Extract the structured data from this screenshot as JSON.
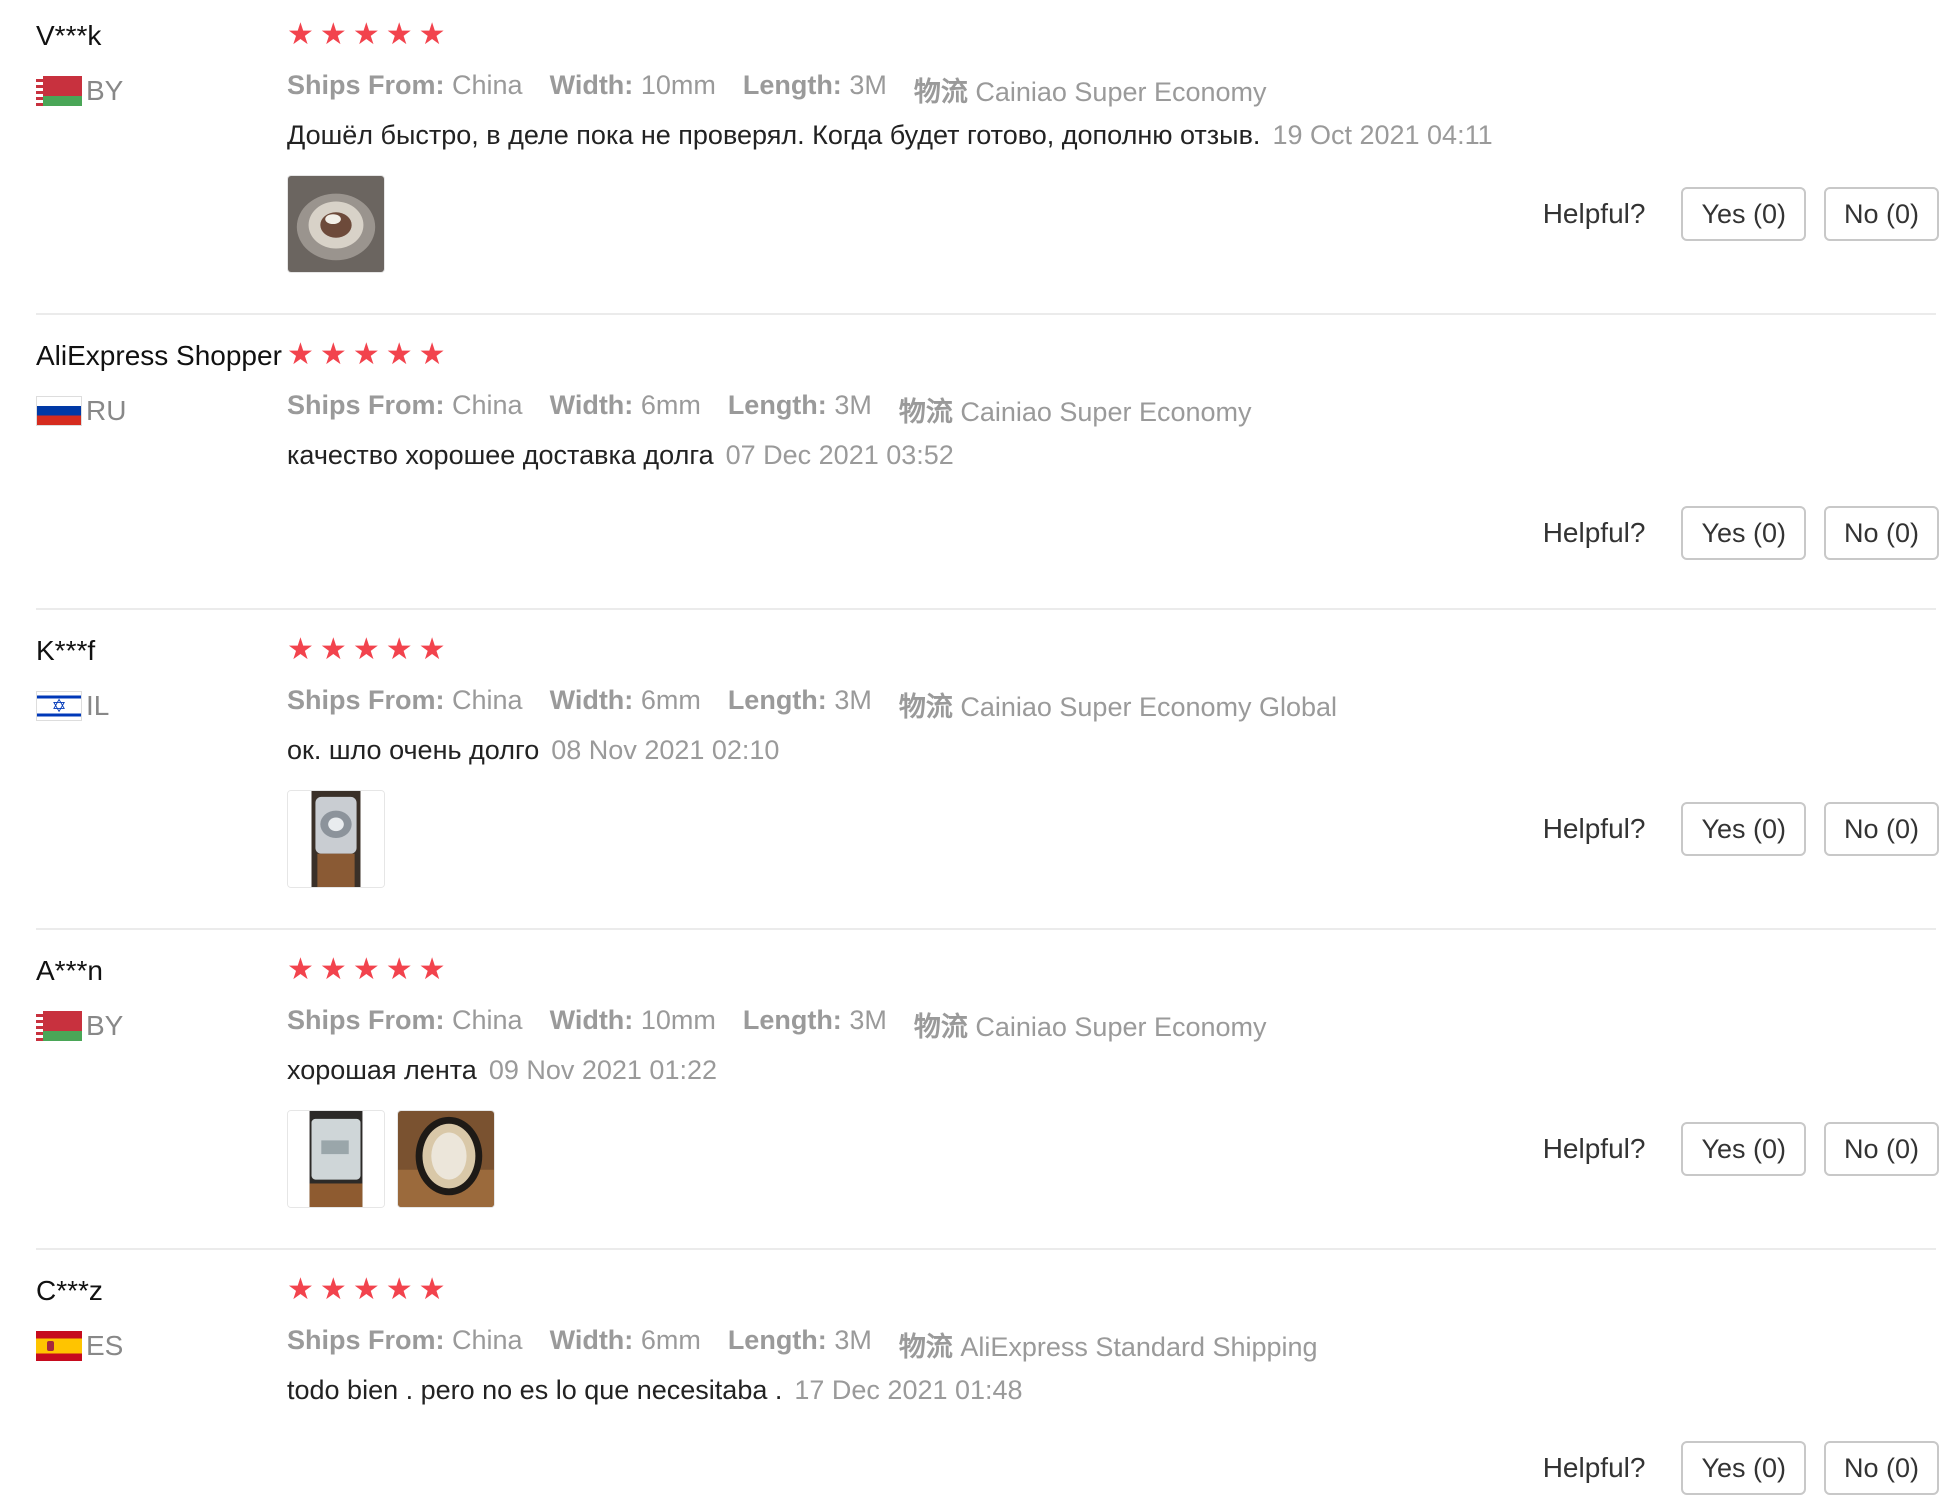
{
  "labels": {
    "ships_from": "Ships From:",
    "width": "Width:",
    "length": "Length:",
    "logistics": "物流",
    "helpful": "Helpful?",
    "star_glyph": "★"
  },
  "reviews": [
    {
      "user": "V***k",
      "country": "BY",
      "flag": "flag-belarus",
      "rating": 5,
      "ships_from": "China",
      "width": "10mm",
      "length": "3M",
      "logistics": "Cainiao Super Economy",
      "feedback": "Дошёл быстро, в деле пока не проверял. Когда будет готово, дополню отзыв.",
      "date": "19 Oct 2021 04:11",
      "photos": [
        "photo-tape-roll"
      ],
      "yes": "Yes (0)",
      "no": "No (0)"
    },
    {
      "user": "AliExpress Shopper",
      "country": "RU",
      "flag": "flag-russia",
      "rating": 5,
      "ships_from": "China",
      "width": "6mm",
      "length": "3M",
      "logistics": "Cainiao Super Economy",
      "feedback": "качество хорошее доставка долга",
      "date": "07 Dec 2021 03:52",
      "photos": [],
      "yes": "Yes (0)",
      "no": "No (0)"
    },
    {
      "user": "K***f",
      "country": "IL",
      "flag": "flag-israel",
      "rating": 5,
      "ships_from": "China",
      "width": "6mm",
      "length": "3M",
      "logistics": "Cainiao Super Economy Global",
      "feedback": "ок. шло очень долго",
      "date": "08 Nov 2021 02:10",
      "photos": [
        "photo-package-in-hand"
      ],
      "yes": "Yes (0)",
      "no": "No (0)"
    },
    {
      "user": "A***n",
      "country": "BY",
      "flag": "flag-belarus",
      "rating": 5,
      "ships_from": "China",
      "width": "10mm",
      "length": "3M",
      "logistics": "Cainiao Super Economy",
      "feedback": "хорошая лента",
      "date": "09 Nov 2021 01:22",
      "photos": [
        "photo-package-bag",
        "photo-tape-ring"
      ],
      "yes": "Yes (0)",
      "no": "No (0)"
    },
    {
      "user": "C***z",
      "country": "ES",
      "flag": "flag-spain",
      "rating": 5,
      "ships_from": "China",
      "width": "6mm",
      "length": "3M",
      "logistics": "AliExpress Standard Shipping",
      "feedback": "todo bien . pero no es lo que necesitaba .",
      "date": "17 Dec 2021 01:48",
      "photos": [],
      "yes": "Yes (0)",
      "no": "No (0)"
    }
  ]
}
